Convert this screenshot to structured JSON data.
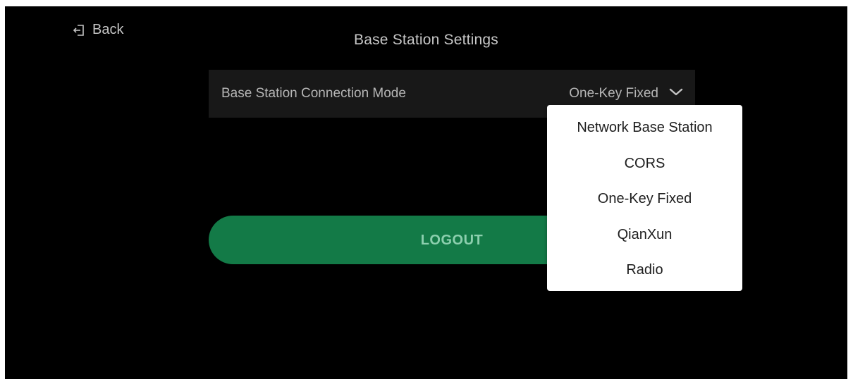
{
  "header": {
    "back_label": "Back",
    "back_icon": "exit-arrow-icon",
    "title": "Base Station Settings"
  },
  "settings": {
    "connection_mode_label": "Base Station Connection Mode",
    "connection_mode_value": "One-Key Fixed",
    "chevron_icon": "chevron-down-icon"
  },
  "actions": {
    "logout_label": "LOGOUT"
  },
  "dropdown": {
    "options": [
      {
        "label": "Network Base Station"
      },
      {
        "label": "CORS"
      },
      {
        "label": "One-Key Fixed"
      },
      {
        "label": "QianXun"
      },
      {
        "label": "Radio"
      }
    ],
    "selected": "One-Key Fixed"
  },
  "colors": {
    "background": "#000000",
    "row_background": "#181818",
    "logout_background": "#137a47",
    "logout_text": "#8ccfae",
    "dropdown_background": "#ffffff",
    "text_primary": "#c6c6c6"
  }
}
